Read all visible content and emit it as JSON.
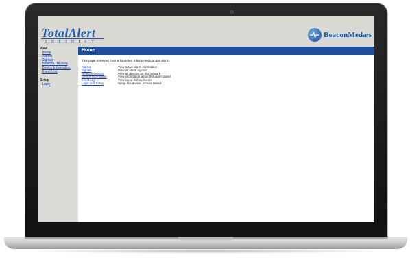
{
  "header": {
    "logo_total": "TotalAlert",
    "logo_infinity": "INFINITY",
    "beacon_logo": "BeaconMedæs"
  },
  "sidebar": {
    "view_heading": "View",
    "view_items": [
      "Home",
      "Alarms",
      "Signals",
      "Network Devices",
      "Device Information",
      "Event Log"
    ],
    "setup_heading": "Setup",
    "setup_items": [
      "Login"
    ]
  },
  "content": {
    "title": "Home",
    "intro": "This page is served from a TotalAlert Infinity medical gas alarm.",
    "links": [
      {
        "label": "Alarms",
        "desc": "View active alarm information"
      },
      {
        "label": "Signals",
        "desc": "View all alarm signals"
      },
      {
        "label": "Network Devices",
        "desc": "View all devices on this network"
      },
      {
        "label": "Device Information",
        "desc": "View information about this alarm panel"
      },
      {
        "label": "Event Log",
        "desc": "View log of history events"
      },
      {
        "label": "Login and Setup",
        "desc": "Setup this device, access limited"
      }
    ]
  },
  "colors": {
    "brand_blue": "#1e4f9a",
    "header_bg": "#d9d8d2",
    "sidebar_bg": "#dcdcd6"
  }
}
